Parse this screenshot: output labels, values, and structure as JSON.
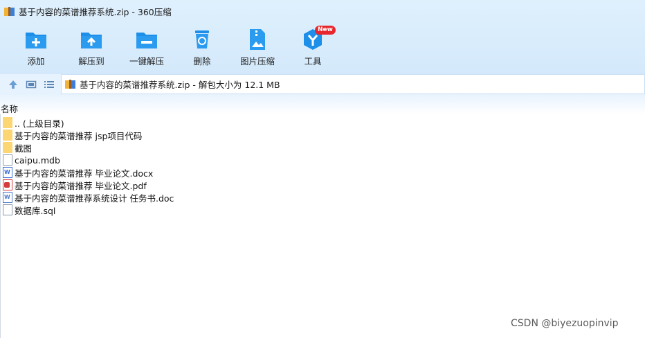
{
  "window": {
    "title": "基于内容的菜谱推荐系统.zip - 360压缩"
  },
  "toolbar": {
    "add": "添加",
    "extract_to": "解压到",
    "one_click_extract": "一键解压",
    "delete": "删除",
    "image_compress": "图片压缩",
    "tools": "工具",
    "tools_badge": "New"
  },
  "address": {
    "text": "基于内容的菜谱推荐系统.zip - 解包大小为 12.1 MB"
  },
  "columns": {
    "name": "名称"
  },
  "files": [
    {
      "name": ".. (上级目录)",
      "icon": "folder-icon"
    },
    {
      "name": "基于内容的菜谱推荐 jsp项目代码",
      "icon": "folder-icon"
    },
    {
      "name": "截图",
      "icon": "folder-icon"
    },
    {
      "name": "caipu.mdb",
      "icon": "file-icon"
    },
    {
      "name": "基于内容的菜谱推荐 毕业论文.docx",
      "icon": "word-icon"
    },
    {
      "name": "基于内容的菜谱推荐 毕业论文.pdf",
      "icon": "pdf-icon"
    },
    {
      "name": "基于内容的菜谱推荐系统设计 任务书.doc",
      "icon": "doc-icon"
    },
    {
      "name": "数据库.sql",
      "icon": "file-icon"
    }
  ],
  "watermark": "CSDN @biyezuopinvip",
  "colors": {
    "accent": "#1e8fe8",
    "toolbar_bg": "#d9edfc",
    "folder": "#fcd672",
    "badge": "#e8262c"
  }
}
